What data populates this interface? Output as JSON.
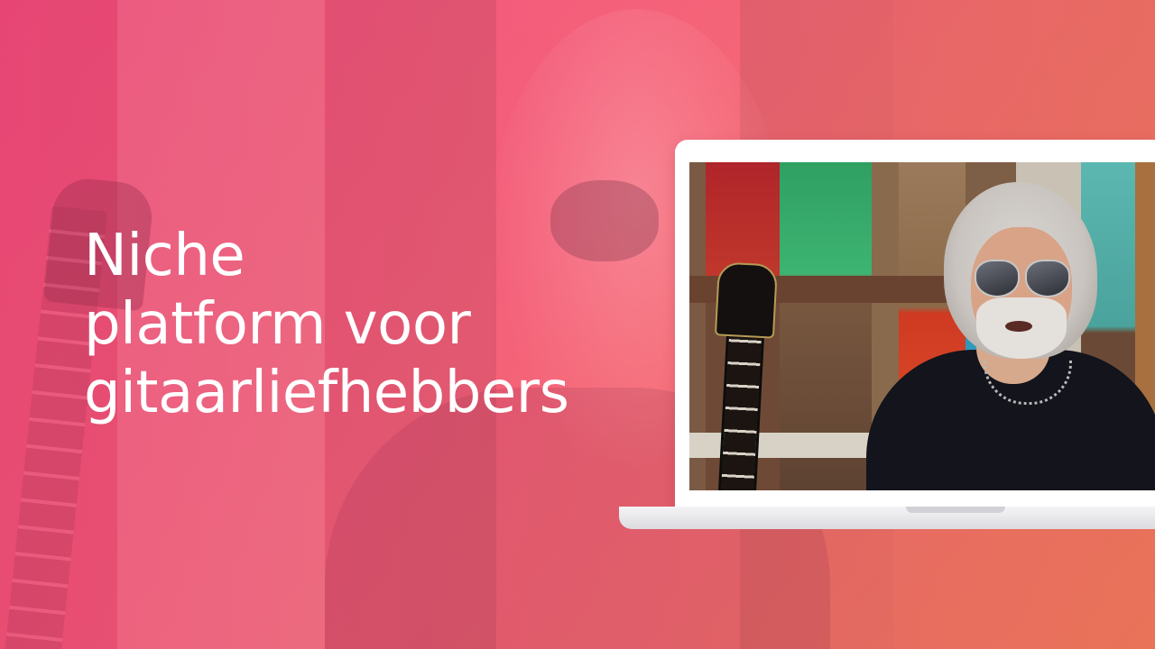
{
  "headline": {
    "line1": "Niche",
    "line2": "platform voor",
    "line3": "gitaarliefhebbers"
  },
  "colors": {
    "gradient_start": "#f2517f",
    "gradient_end": "#f57a5f",
    "headline_text": "#ffffff",
    "laptop_frame": "#ffffff"
  }
}
